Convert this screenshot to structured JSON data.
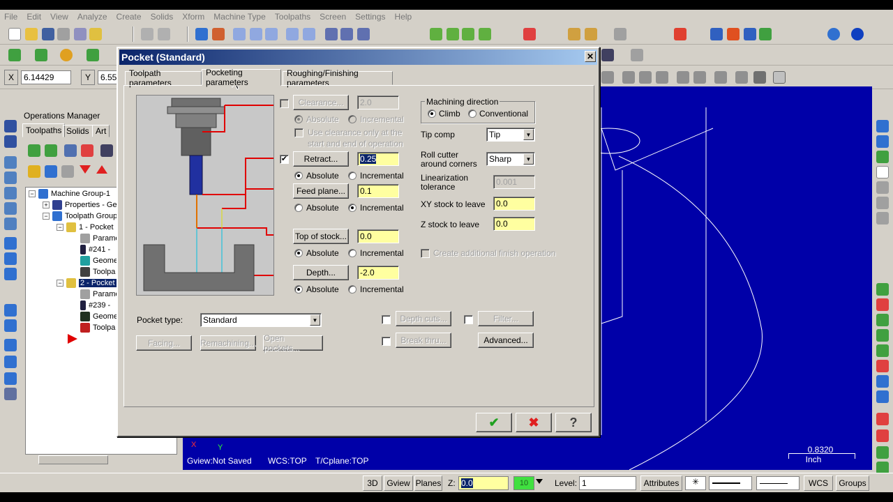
{
  "menu": [
    "File",
    "Edit",
    "View",
    "Analyze",
    "Create",
    "Solids",
    "Xform",
    "Machine Type",
    "Toolpaths",
    "Screen",
    "Settings",
    "Help"
  ],
  "coords": {
    "x_label": "X",
    "x_value": "6.14429",
    "y_label": "Y",
    "y_value": "6.55"
  },
  "ops_manager": {
    "title": "Operations Manager",
    "tabs": [
      "Toolpaths",
      "Solids",
      "Art"
    ],
    "tree": [
      {
        "label": "Machine Group-1",
        "indent": 0,
        "expander": "−"
      },
      {
        "label": "Properties - Ge",
        "indent": 1,
        "expander": "+"
      },
      {
        "label": "Toolpath Group",
        "indent": 1,
        "expander": "−"
      },
      {
        "label": "1 - Pocket",
        "indent": 2,
        "expander": "−"
      },
      {
        "label": "Parame",
        "indent": 3,
        "expander": ""
      },
      {
        "label": "#241 -",
        "indent": 3,
        "expander": ""
      },
      {
        "label": "Geome",
        "indent": 3,
        "expander": ""
      },
      {
        "label": "Toolpa",
        "indent": 3,
        "expander": ""
      },
      {
        "label": "2 - Pocket",
        "indent": 2,
        "expander": "−",
        "selected": true
      },
      {
        "label": "Parame",
        "indent": 3,
        "expander": ""
      },
      {
        "label": "#239 -",
        "indent": 3,
        "expander": ""
      },
      {
        "label": "Geome",
        "indent": 3,
        "expander": ""
      },
      {
        "label": "Toolpa",
        "indent": 3,
        "expander": ""
      }
    ]
  },
  "dialog": {
    "title": "Pocket (Standard)",
    "close": "✕",
    "tabs": [
      "Toolpath parameters",
      "Pocketing parameters",
      "Roughing/Finishing parameters"
    ],
    "clearance": {
      "label": "Clearance...",
      "value": "2.0",
      "absolute": "Absolute",
      "incremental": "Incremental",
      "use_only": "Use clearance only at the",
      "use_only2": "start and end of operation"
    },
    "retract": {
      "label": "Retract...",
      "value": "0.25",
      "absolute": "Absolute",
      "incremental": "Incremental"
    },
    "feed_plane": {
      "label": "Feed plane...",
      "value": "0.1",
      "absolute": "Absolute",
      "incremental": "Incremental"
    },
    "top_of_stock": {
      "label": "Top of stock...",
      "value": "0.0",
      "absolute": "Absolute",
      "incremental": "Incremental"
    },
    "depth": {
      "label": "Depth...",
      "value": "-2.0",
      "absolute": "Absolute",
      "incremental": "Incremental"
    },
    "machining_direction": {
      "title": "Machining direction",
      "climb": "Climb",
      "conventional": "Conventional"
    },
    "tip_comp": {
      "label": "Tip comp",
      "value": "Tip"
    },
    "roll_cutter": {
      "label1": "Roll cutter",
      "label2": "around corners",
      "value": "Sharp"
    },
    "linearization": {
      "label1": "Linearization",
      "label2": "tolerance",
      "value": "0.001"
    },
    "xy_stock": {
      "label": "XY stock to leave",
      "value": "0.0"
    },
    "z_stock": {
      "label": "Z stock to leave",
      "value": "0.0"
    },
    "finish_op": "Create additional finish operation",
    "pocket_type": {
      "label": "Pocket type:",
      "value": "Standard"
    },
    "buttons": {
      "facing": "Facing...",
      "remachining": "Remachining...",
      "open_pockets": "Open pockets...",
      "depth_cuts": "Depth cuts...",
      "filter": "Filter...",
      "break_thru": "Break thru...",
      "advanced": "Advanced..."
    },
    "ok": "✔",
    "cancel": "✖",
    "help": "?"
  },
  "viewport": {
    "gview": "Gview:Not Saved",
    "wcs": "WCS:TOP",
    "tcplane": "T/Cplane:TOP",
    "scale_value": "0.8320",
    "scale_unit": "Inch",
    "axis_x": "X",
    "axis_y": "Y"
  },
  "statusbar": {
    "view3d": "3D",
    "gview": "Gview",
    "planes": "Planes",
    "z_label": "Z:",
    "z_value": "0.0",
    "color_value": "10",
    "level_label": "Level:",
    "level_value": "1",
    "attributes": "Attributes",
    "wcs": "WCS",
    "groups": "Groups"
  },
  "colors": {
    "viewport": "#0000a8",
    "titlebar": "#0a246a",
    "field": "#ffffa0"
  }
}
